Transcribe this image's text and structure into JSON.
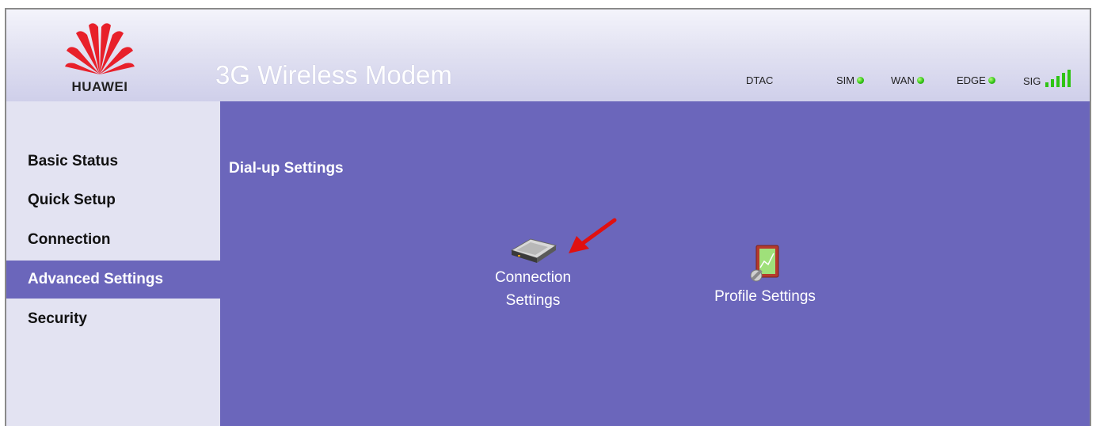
{
  "brand": {
    "name": "HUAWEI",
    "logo_color": "#e8202a"
  },
  "header": {
    "title": "3G Wireless Modem"
  },
  "status_bar": {
    "operator": "DTAC",
    "indicators": [
      {
        "label": "SIM",
        "icon": "green-status-dot"
      },
      {
        "label": "WAN",
        "icon": "green-status-dot"
      },
      {
        "label": "EDGE",
        "icon": "green-status-dot"
      },
      {
        "label": "SIG",
        "icon": "signal-bars-icon",
        "level": "5/5"
      }
    ]
  },
  "sidebar": {
    "items": [
      {
        "label": "Basic Status"
      },
      {
        "label": "Quick Setup"
      },
      {
        "label": "Connection"
      },
      {
        "label": "Advanced Settings",
        "active": true
      },
      {
        "label": "Security"
      }
    ]
  },
  "main": {
    "title": "Dial-up Settings",
    "tiles": [
      {
        "label_line1": "Connection",
        "label_line2": "Settings",
        "icon": "hard-drive-icon"
      },
      {
        "label": "Profile Settings",
        "icon": "profile-settings-icon"
      }
    ]
  },
  "colors": {
    "accent": "#6b66bb",
    "sidebar_bg": "#e3e3f2",
    "status_green": "#2fc414",
    "arrow_red": "#e01010"
  }
}
